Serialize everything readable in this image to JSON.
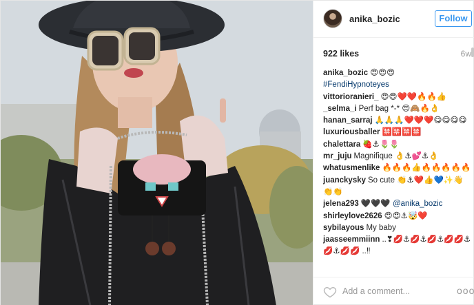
{
  "header": {
    "username": "anika_bozic",
    "follow_label": "Follow"
  },
  "post": {
    "likes": "922 likes",
    "age": "6w"
  },
  "caption": {
    "username": "anika_bozic",
    "text": "😍😍😍",
    "hashtag": "#FendiHypnoteyes"
  },
  "comments": [
    {
      "username": "vittorioranieri_",
      "text": "😍😍❤️❤️🔥🔥👍"
    },
    {
      "username": "_selma_i",
      "text": "Perf bag *-* 😍🙈🔥👌"
    },
    {
      "username": "hanan_sarraj",
      "text": "🙏🙏🙏❤️❤️❤️😋😋😋😋"
    },
    {
      "username": "luxuriousballer",
      "text": "🈲🈲🈲🈲"
    },
    {
      "username": "chalettara",
      "text": "🍓⚓🌷🌷"
    },
    {
      "username": "mr_juju",
      "text": "Magnifique 👌⚓💕⚓👌"
    },
    {
      "username": "whatusmenlike",
      "text": "🔥🔥🔥👍🔥🔥🔥🔥🔥"
    },
    {
      "username": "juanckysky",
      "text": "So cute 👏⚓❤️👍💙✨👋👏👏"
    },
    {
      "username": "jelena293",
      "text": "🖤🖤🖤",
      "mention": "@anika_bozic"
    },
    {
      "username": "shirleylove2626",
      "text": "😍😍⚓🤯❤️"
    },
    {
      "username": "sybilayous",
      "text": "My baby"
    },
    {
      "username": "jaasseemmiinn",
      "text": "..❣💋⚓💋⚓💋⚓💋💋⚓💋⚓💋💋 ..‼"
    }
  ],
  "footer": {
    "add_comment_placeholder": "Add a comment...",
    "more_label": "ooo"
  },
  "colors": {
    "accent": "#3897f0",
    "link": "#003569",
    "muted": "#999999",
    "border": "#efefef"
  },
  "icons": {
    "like": "heart-outline-icon",
    "more": "ellipsis-icon"
  }
}
